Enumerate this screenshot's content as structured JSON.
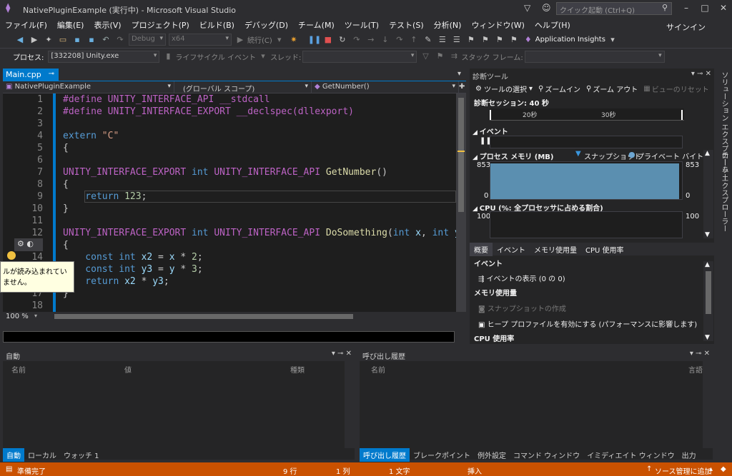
{
  "window": {
    "title": "NativePluginExample (実行中) - Microsoft Visual Studio",
    "quick_launch_placeholder": "クイック起動 (Ctrl+Q)",
    "signin": "サインイン"
  },
  "menu": [
    "ファイル(F)",
    "編集(E)",
    "表示(V)",
    "プロジェクト(P)",
    "ビルド(B)",
    "デバッグ(D)",
    "チーム(M)",
    "ツール(T)",
    "テスト(S)",
    "分析(N)",
    "ウィンドウ(W)",
    "ヘルプ(H)"
  ],
  "toolbar": {
    "config": "Debug",
    "platform": "x64",
    "continue_label": "続行(C)",
    "app_insights": "Application Insights"
  },
  "debug_bar": {
    "process_label": "プロセス:",
    "process_value": "[332208] Unity.exe",
    "lifecycle": "ライフサイクル イベント",
    "thread_label": "スレッド:",
    "stack_frame_label": "スタック フレーム:"
  },
  "editor": {
    "tab": "Main.cpp",
    "project_scope": "NativePluginExample",
    "global_scope": "(グローバル スコープ)",
    "member": "GetNumber()",
    "zoom": "100 %",
    "lines": [
      {
        "n": "1",
        "tokens": [
          [
            "mac",
            "#define UNITY_INTERFACE_API __stdcall"
          ]
        ]
      },
      {
        "n": "2",
        "tokens": [
          [
            "mac",
            "#define UNITY_INTERFACE_EXPORT __declspec(dllexport)"
          ]
        ]
      },
      {
        "n": "3",
        "tokens": []
      },
      {
        "n": "4",
        "tokens": [
          [
            "kw",
            "extern "
          ],
          [
            "str",
            "\"C\""
          ]
        ]
      },
      {
        "n": "5",
        "tokens": [
          [
            "df",
            "{"
          ]
        ]
      },
      {
        "n": "6",
        "tokens": []
      },
      {
        "n": "7",
        "tokens": [
          [
            "mac",
            "UNITY_INTERFACE_EXPORT "
          ],
          [
            "kw",
            "int "
          ],
          [
            "mac",
            "UNITY_INTERFACE_API "
          ],
          [
            "fn",
            "GetNumber"
          ],
          [
            "df",
            "()"
          ]
        ]
      },
      {
        "n": "8",
        "tokens": [
          [
            "df",
            "{"
          ]
        ]
      },
      {
        "n": "9",
        "tokens": [
          [
            "kw",
            "    return "
          ],
          [
            "num",
            "123"
          ],
          [
            "df",
            ";"
          ]
        ]
      },
      {
        "n": "10",
        "tokens": [
          [
            "df",
            "}"
          ]
        ]
      },
      {
        "n": "11",
        "tokens": []
      },
      {
        "n": "12",
        "tokens": [
          [
            "mac",
            "UNITY_INTERFACE_EXPORT "
          ],
          [
            "kw",
            "int "
          ],
          [
            "mac",
            "UNITY_INTERFACE_API "
          ],
          [
            "fn",
            "DoSomething"
          ],
          [
            "df",
            "("
          ],
          [
            "kw",
            "int "
          ],
          [
            "par",
            "x"
          ],
          [
            "df",
            ", "
          ],
          [
            "kw",
            "int "
          ],
          [
            "par",
            "y"
          ],
          [
            "df",
            ")"
          ]
        ]
      },
      {
        "n": "13",
        "tokens": [
          [
            "df",
            "{"
          ]
        ]
      },
      {
        "n": "14",
        "tokens": [
          [
            "kw",
            "    const int "
          ],
          [
            "par",
            "x2"
          ],
          [
            "df",
            " = "
          ],
          [
            "par",
            "x"
          ],
          [
            "df",
            " * "
          ],
          [
            "num",
            "2"
          ],
          [
            "df",
            ";"
          ]
        ]
      },
      {
        "n": "15",
        "tokens": [
          [
            "kw",
            "    const int "
          ],
          [
            "par",
            "y3"
          ],
          [
            "df",
            " = "
          ],
          [
            "par",
            "y"
          ],
          [
            "df",
            " * "
          ],
          [
            "num",
            "3"
          ],
          [
            "df",
            ";"
          ]
        ]
      },
      {
        "n": "16",
        "tokens": [
          [
            "kw",
            "    return "
          ],
          [
            "par",
            "x2"
          ],
          [
            "df",
            " * "
          ],
          [
            "par",
            "y3"
          ],
          [
            "df",
            ";"
          ]
        ]
      },
      {
        "n": "17",
        "tokens": [
          [
            "df",
            "}"
          ]
        ]
      },
      {
        "n": "18",
        "tokens": []
      }
    ],
    "tooltip": "ルが読み込まれていません。"
  },
  "diagnostics": {
    "title": "診断ツール",
    "select_tools": "ツールの選択",
    "zoom_in": "ズームイン",
    "zoom_out": "ズーム アウト",
    "reset_view": "ビューのリセット",
    "session": "診断セッション: 40 秒",
    "tick_20": "20秒",
    "tick_30": "30秒",
    "events_label": "イベント",
    "memory_label": "プロセス メモリ (MB)",
    "snapshot_legend": "スナップショット",
    "private_bytes_legend": "プライベート バイト",
    "mem_max": "853",
    "mem_min": "0",
    "cpu_label": "CPU (%: 全プロセッサに占める割合)",
    "cpu_max": "100",
    "tabs": [
      "概要",
      "イベント",
      "メモリ使用量",
      "CPU 使用率"
    ],
    "events_header": "イベント",
    "show_events": "イベントの表示 (0 の 0)",
    "memory_header": "メモリ使用量",
    "take_snapshot": "スナップショットの作成",
    "heap_profiling": "ヒープ プロファイルを有効にする (パフォーマンスに影響します)",
    "cpu_header": "CPU 使用率"
  },
  "side_strip": [
    "ソリューション エクスプローラー",
    "チーム エクスプローラー"
  ],
  "autos": {
    "title": "自動",
    "col_name": "名前",
    "col_value": "値",
    "col_type": "種類",
    "tabs": [
      "自動",
      "ローカル",
      "ウォッチ 1"
    ]
  },
  "callstack": {
    "title": "呼び出し履歴",
    "col_name": "名前",
    "col_lang": "言語",
    "tabs": [
      "呼び出し履歴",
      "ブレークポイント",
      "例外設定",
      "コマンド ウィンドウ",
      "イミディエイト ウィンドウ",
      "出力"
    ]
  },
  "status": {
    "ready": "準備完了",
    "line": "9 行",
    "col": "1 列",
    "ch": "1 文字",
    "mode": "挿入",
    "source_control": "ソース管理に追加"
  },
  "colors": {
    "accent": "#007acc",
    "status": "#ca5100"
  }
}
